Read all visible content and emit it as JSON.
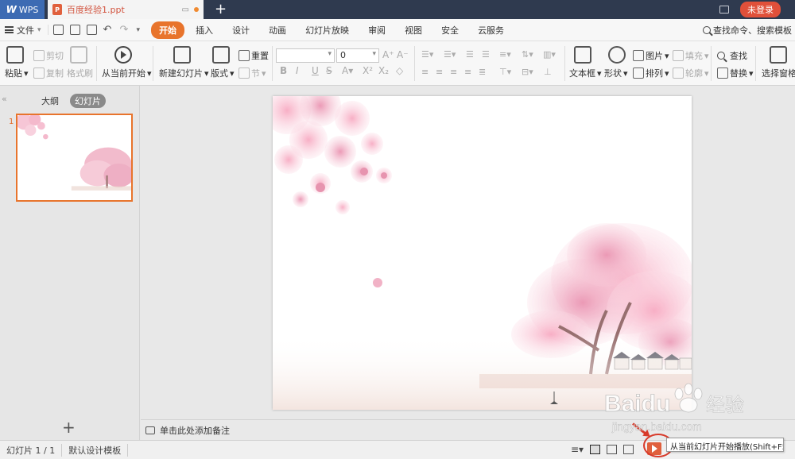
{
  "titlebar": {
    "app_label": "WPS",
    "doc_tab_label": "百度经验1.ppt",
    "login_label": "未登录"
  },
  "menu": {
    "file_label": "文件",
    "tabs": [
      "开始",
      "插入",
      "设计",
      "动画",
      "幻灯片放映",
      "审阅",
      "视图",
      "安全",
      "云服务"
    ],
    "search_label": "查找命令、搜索模板"
  },
  "ribbon": {
    "paste": "粘贴",
    "cut": "剪切",
    "copy": "复制",
    "format_painter": "格式刷",
    "play_from_current": "从当前开始",
    "new_slide": "新建幻灯片",
    "layout": "版式",
    "reset": "重置",
    "section": "节",
    "font_size_value": "0",
    "text_box": "文本框",
    "shape": "形状",
    "picture": "图片",
    "fill": "填充",
    "arrange": "排列",
    "outline": "轮廓",
    "find": "查找",
    "replace": "替换",
    "select_pane": "选择窗格"
  },
  "left_panel": {
    "outline_tab": "大纲",
    "slides_tab": "幻灯片",
    "slide_number": "1",
    "add_label": "+"
  },
  "notes": {
    "placeholder": "单击此处添加备注"
  },
  "statusbar": {
    "slide_counter": "幻灯片 1 / 1",
    "template": "默认设计模板",
    "tooltip": "从当前幻灯片开始播放(Shift+F5)"
  },
  "watermark": {
    "brand": "Baidu",
    "brand_cn": "经验",
    "url": "jingyan.baidu.com"
  },
  "colors": {
    "accent": "#e8742c",
    "title_bg": "#2f3a4f",
    "login_red": "#e0503a",
    "wps_blue": "#3d6bb3",
    "blossom_pink": "#f2a8c0"
  }
}
